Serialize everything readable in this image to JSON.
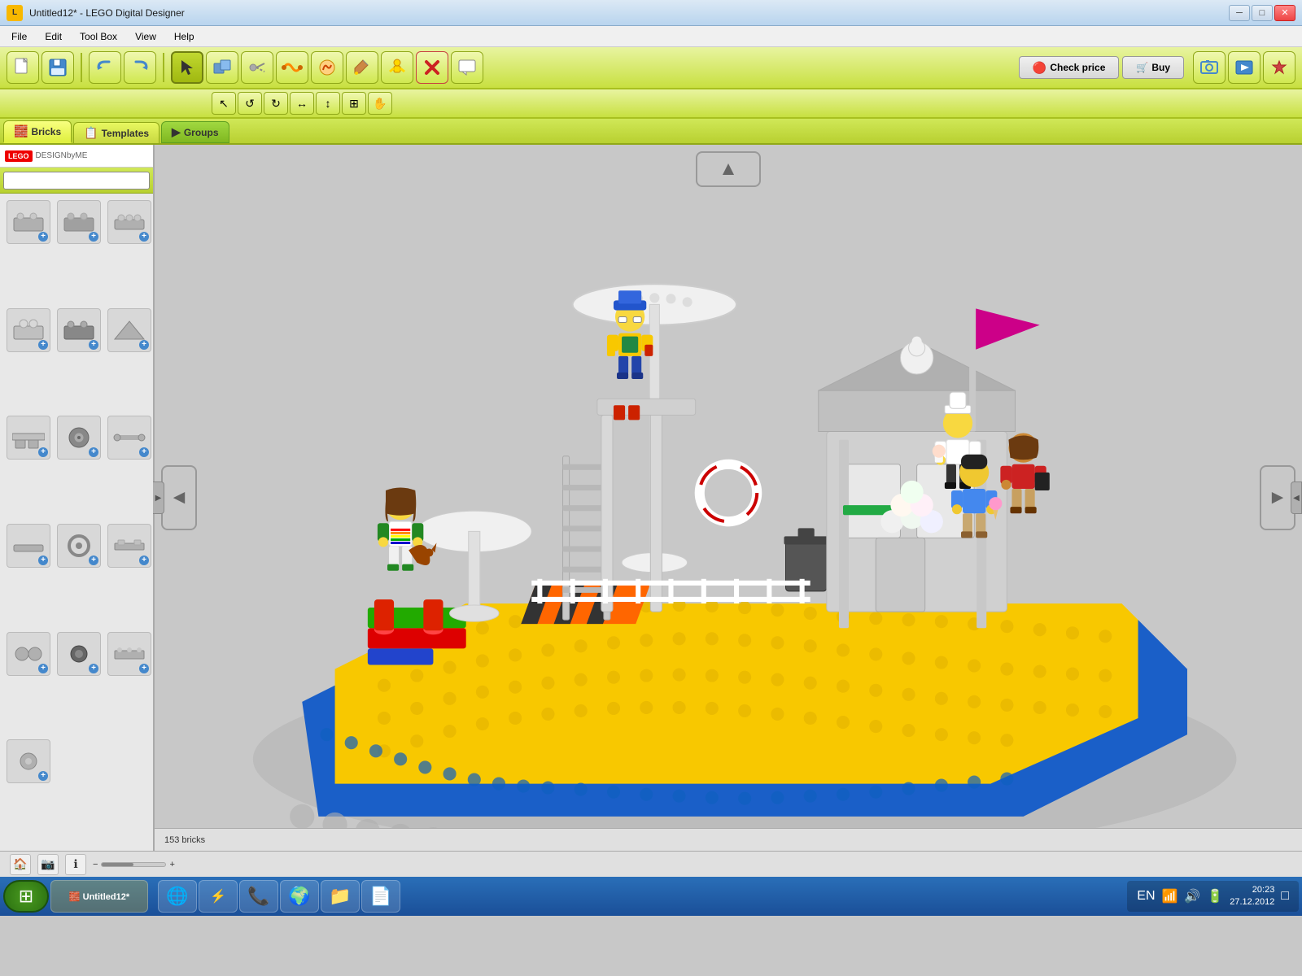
{
  "window": {
    "title": "Untitled12* - LEGO Digital Designer",
    "icon": "🧱"
  },
  "menu": {
    "items": [
      "File",
      "Edit",
      "Tool Box",
      "View",
      "Help"
    ]
  },
  "toolbar": {
    "tools": [
      {
        "name": "select",
        "icon": "↖",
        "label": "Select"
      },
      {
        "name": "clone",
        "icon": "⧉",
        "label": "Clone"
      },
      {
        "name": "hinge",
        "icon": "⚙",
        "label": "Hinge"
      },
      {
        "name": "flex",
        "icon": "〰",
        "label": "Flex"
      },
      {
        "name": "decal",
        "icon": "🔗",
        "label": "Decal"
      },
      {
        "name": "paint",
        "icon": "🎨",
        "label": "Paint"
      },
      {
        "name": "eye",
        "icon": "👁",
        "label": "Minifig"
      },
      {
        "name": "delete",
        "icon": "✕",
        "label": "Delete"
      },
      {
        "name": "comment",
        "icon": "💬",
        "label": "Comment"
      }
    ],
    "right_tools": [
      {
        "name": "screenshot",
        "icon": "📷",
        "label": "Screenshot"
      },
      {
        "name": "share",
        "icon": "📤",
        "label": "Share"
      },
      {
        "name": "heart",
        "icon": "❤",
        "label": "Favorite"
      }
    ]
  },
  "secondary_toolbar": {
    "tools": [
      {
        "name": "pointer",
        "icon": "↖",
        "label": "Pointer"
      },
      {
        "name": "rotate-left",
        "icon": "↺",
        "label": "Rotate Left"
      },
      {
        "name": "rotate-right",
        "icon": "↻",
        "label": "Rotate Right"
      },
      {
        "name": "flip-h",
        "icon": "↔",
        "label": "Flip H"
      },
      {
        "name": "flip-v",
        "icon": "↕",
        "label": "Flip V"
      },
      {
        "name": "snap",
        "icon": "⊞",
        "label": "Snap"
      },
      {
        "name": "hand",
        "icon": "✋",
        "label": "Hand"
      }
    ]
  },
  "tabs": {
    "items": [
      {
        "id": "bricks",
        "label": "Bricks",
        "icon": "🧱",
        "active": true
      },
      {
        "id": "templates",
        "label": "Templates",
        "icon": "📋",
        "active": false
      },
      {
        "id": "groups",
        "label": "Groups",
        "icon": "▶",
        "active": false
      }
    ]
  },
  "sidebar": {
    "search_placeholder": "",
    "bricks": [
      {
        "row": 0,
        "col": 0,
        "shape": "flat-plate",
        "color": "#c0c0c0"
      },
      {
        "row": 0,
        "col": 1,
        "shape": "flat-plate-gray",
        "color": "#a0a0a0"
      },
      {
        "row": 0,
        "col": 2,
        "shape": "plate-studs",
        "color": "#b0b0b0"
      },
      {
        "row": 1,
        "col": 0,
        "shape": "round-stud",
        "color": "#c0c0c0"
      },
      {
        "row": 1,
        "col": 1,
        "shape": "flat-dark",
        "color": "#888"
      },
      {
        "row": 1,
        "col": 2,
        "shape": "angle-brick",
        "color": "#b0b0b0"
      },
      {
        "row": 2,
        "col": 0,
        "shape": "cylinder",
        "color": "#b0b0b0"
      },
      {
        "row": 2,
        "col": 1,
        "shape": "gear",
        "color": "#888"
      },
      {
        "row": 2,
        "col": 2,
        "shape": "pin",
        "color": "#b0b0b0"
      },
      {
        "row": 3,
        "col": 0,
        "shape": "tile",
        "color": "#b0b0b0"
      },
      {
        "row": 3,
        "col": 1,
        "shape": "wheel",
        "color": "#888"
      },
      {
        "row": 3,
        "col": 2,
        "shape": "long-plate",
        "color": "#b0b0b0"
      },
      {
        "row": 4,
        "col": 0,
        "shape": "sphere",
        "color": "#b0b0b0"
      },
      {
        "row": 4,
        "col": 1,
        "shape": "stud-dark",
        "color": "#666"
      },
      {
        "row": 4,
        "col": 2,
        "shape": "connector",
        "color": "#b0b0b0"
      },
      {
        "row": 5,
        "col": 0,
        "shape": "round-plate",
        "color": "#b0b0b0"
      }
    ]
  },
  "action_buttons": {
    "check_price_label": "Check price",
    "check_price_icon": "🔴",
    "buy_label": "Buy",
    "buy_icon": "🛒"
  },
  "canvas": {
    "nav_up": "▲",
    "nav_left": "◄",
    "nav_right": "►"
  },
  "status_bar": {
    "brick_count": "153 bricks"
  },
  "taskbar": {
    "apps": [
      {
        "name": "chrome",
        "icon": "🌐"
      },
      {
        "name": "torrent",
        "icon": "⚡"
      },
      {
        "name": "skype",
        "icon": "📞"
      },
      {
        "name": "windows-explorer",
        "icon": "📁"
      },
      {
        "name": "ie",
        "icon": "🌍"
      },
      {
        "name": "files",
        "icon": "📄"
      }
    ],
    "tray": {
      "lang": "EN",
      "time": "20:23",
      "date": "27.12.2012"
    }
  },
  "brick_icons": [
    "⬜",
    "⬜",
    "⬛",
    "🔘",
    "⬜",
    "⬜",
    "⚙",
    "🔩",
    "⬜",
    "🔘",
    "⬜",
    "🔩",
    "⚪",
    "⚫",
    "🔌",
    "⬜"
  ]
}
